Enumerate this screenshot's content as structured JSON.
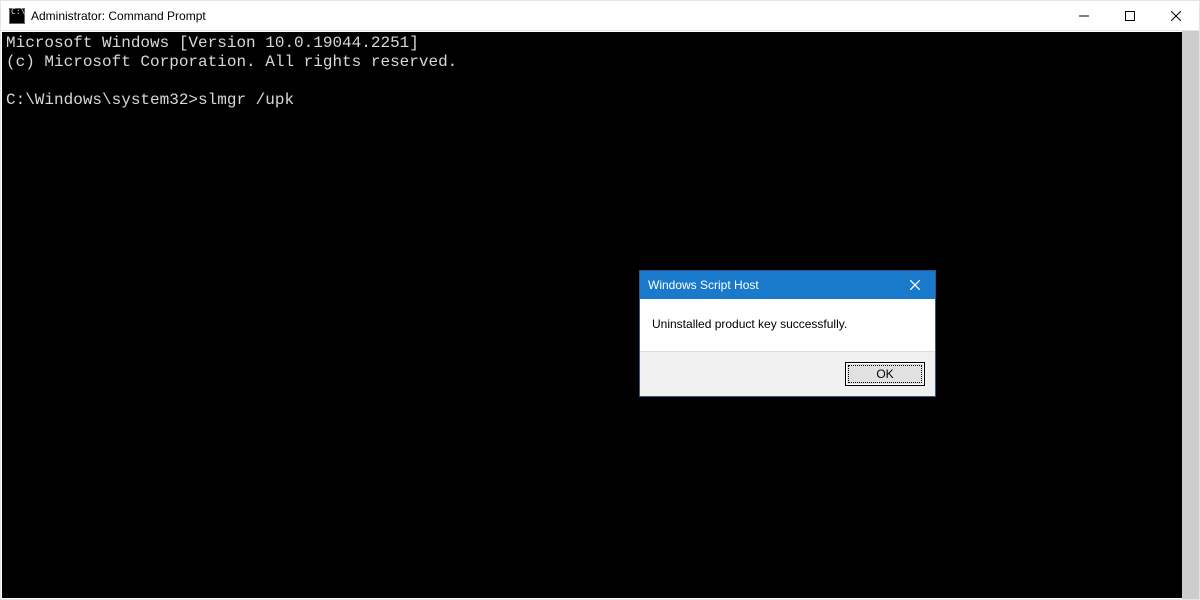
{
  "window": {
    "title": "Administrator: Command Prompt"
  },
  "terminal": {
    "line1": "Microsoft Windows [Version 10.0.19044.2251]",
    "line2": "(c) Microsoft Corporation. All rights reserved.",
    "blank": "",
    "prompt_line": "C:\\Windows\\system32>slmgr /upk"
  },
  "dialog": {
    "title": "Windows Script Host",
    "message": "Uninstalled product key successfully.",
    "ok_label": "OK"
  }
}
